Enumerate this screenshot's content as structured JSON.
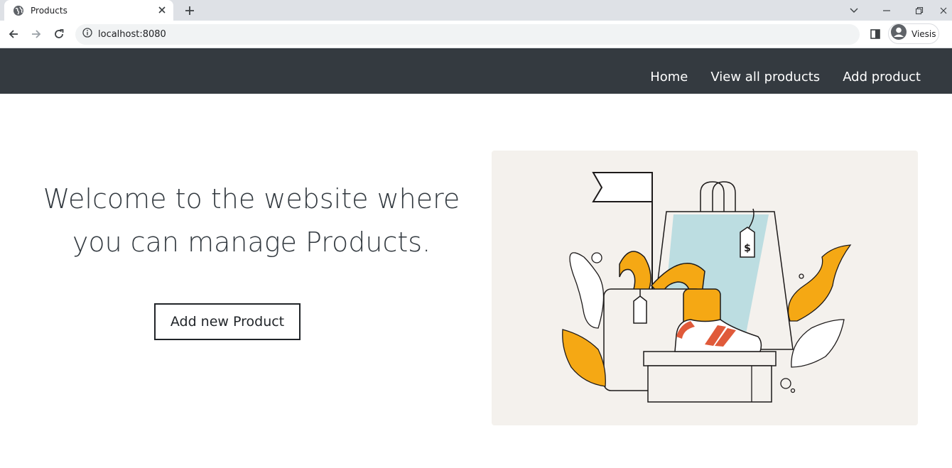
{
  "browser": {
    "tab_title": "Products",
    "url": "localhost:8080",
    "profile_name": "Viesis"
  },
  "nav": {
    "links": [
      "Home",
      "View all products",
      "Add product"
    ]
  },
  "hero": {
    "heading": "Welcome to the website where you can manage Products.",
    "button_label": "Add new Product"
  },
  "illustration": {
    "price_tag_symbol": "$"
  },
  "colors": {
    "navbar_bg": "#343a40",
    "illustration_bg": "#f4f1ed",
    "accent_orange": "#f5a814",
    "accent_blue": "#bcdde1"
  }
}
